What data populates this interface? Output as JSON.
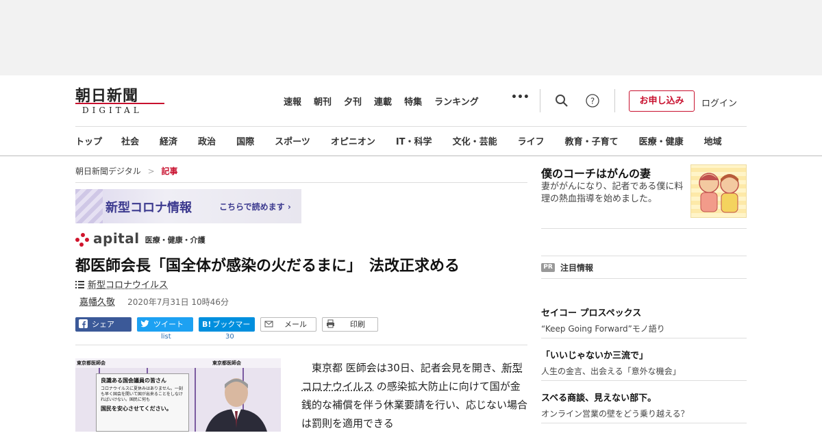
{
  "logo": {
    "main": "朝日新聞",
    "sub": "DIGITAL"
  },
  "topnav": [
    "速報",
    "朝刊",
    "夕刊",
    "連載",
    "特集",
    "ランキング"
  ],
  "more_label": "•••",
  "apply_label": "お申し込み",
  "login_label": "ログイン",
  "categories": [
    "トップ",
    "社会",
    "経済",
    "政治",
    "国際",
    "スポーツ",
    "オピニオン",
    "IT・科学",
    "文化・芸能",
    "ライフ",
    "教育・子育て",
    "医療・健康",
    "地域"
  ],
  "breadcrumb": {
    "home": "朝日新聞デジタル",
    "sep": ">",
    "current": "記事"
  },
  "banner": {
    "title": "新型コロナ情報",
    "cta": "こちらで読めます ›"
  },
  "apital": {
    "logo": "apital",
    "category": "医療・健康・介護"
  },
  "article": {
    "headline": "都医師会長「国全体が感染の火だるまに」　法改正求める",
    "tag": "新型コロナウイルス",
    "author": "嘉幡久敬",
    "date": "2020年7月31日 10時46分",
    "body_pre": "　東京都 医師会は30日、記者会見を開き、",
    "body_link": "新型コロナウイルス",
    "body_post": " の感染拡大防止に向けて国が金銭的な補償を伴う休業要請を行い、応じない場合は罰則を適用できる"
  },
  "share": {
    "facebook": "シェア",
    "twitter": "ツイート",
    "twitter_count": "list",
    "hatena": "ブックマーク",
    "hatena_badge": "B!",
    "hatena_count": "30",
    "mail": "メール",
    "print": "印刷"
  },
  "photo": {
    "label_left": "東京都医師会",
    "label_right": "東京都医師会",
    "sign_title": "良識ある国会議員の皆さん",
    "sign_body": "コロナウイルスに夏休みはありません。一刻も早く国会を開いて国が出来ることをしなければいけない。国民に何も",
    "sign_footer": "国民を安心させてください。"
  },
  "sidebar": {
    "feature_title": "僕のコーチはがんの妻",
    "feature_desc": "妻ががんになり、記者である僕に料理の熱血指導を始めました。",
    "pr_badge": "PR",
    "pr_title": "注目情報",
    "pr_items": [
      {
        "title": "セイコー プロスペックス",
        "desc": "“Keep Going Forward”モノ語り"
      },
      {
        "title": "「いいじゃないか三流で」",
        "desc": "人生の金言、出会える「意外な機会」"
      },
      {
        "title": "スベる商談、見えない部下。",
        "desc": "オンライン営業の壁をどう乗り越える？"
      }
    ]
  },
  "colors": {
    "brand_red": "#c8102e",
    "facebook": "#3b5998",
    "twitter": "#1da1f2",
    "hatena": "#008fde"
  }
}
